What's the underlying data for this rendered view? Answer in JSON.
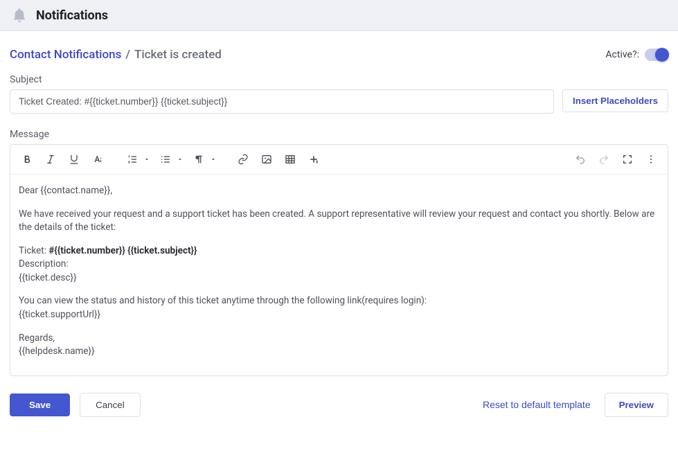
{
  "header": {
    "title": "Notifications"
  },
  "breadcrumb": {
    "parent_label": "Contact Notifications",
    "separator": "/",
    "current_label": "Ticket is created"
  },
  "active": {
    "label": "Active?:",
    "value": true
  },
  "subject": {
    "label": "Subject",
    "value": "Ticket Created: #{{ticket.number}} {{ticket.subject}}"
  },
  "insert_placeholders_label": "Insert Placeholders",
  "message": {
    "label": "Message",
    "body": {
      "line1": "Dear {{contact.name}},",
      "line2": "We have received your request and a support ticket has been created. A support representative will review your request and contact you shortly. Below are the details of the ticket:",
      "line3a": "Ticket: ",
      "line3b_bold": "#{{ticket.number}} {{ticket.subject}}",
      "line4": "Description:",
      "line5": "{{ticket.desc}}",
      "line6": "You can view the status and history of this ticket anytime through the following link(requires login):",
      "line7": "{{ticket.supportUrl}}",
      "line8": "Regards,",
      "line9": "{{helpdesk.name}}"
    }
  },
  "toolbar": {
    "bold": "bold-icon",
    "italic": "italic-icon",
    "underline": "underline-icon",
    "font": "font-options-icon",
    "ol": "ordered-list-icon",
    "ul": "unordered-list-icon",
    "paragraph": "paragraph-icon",
    "link": "link-icon",
    "image": "image-icon",
    "table": "table-icon",
    "insert": "insert-more-icon",
    "undo": "undo-icon",
    "redo": "redo-icon",
    "fullscreen": "fullscreen-icon",
    "more": "more-icon"
  },
  "footer": {
    "save": "Save",
    "cancel": "Cancel",
    "reset": "Reset to default template",
    "preview": "Preview"
  }
}
